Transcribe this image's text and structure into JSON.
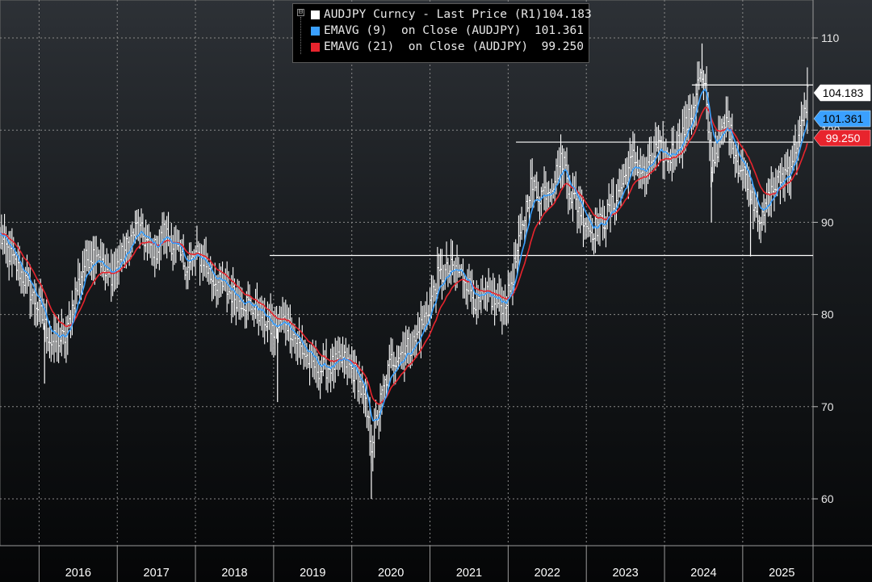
{
  "legend": {
    "collapse_symbol": "⊟",
    "entries": [
      {
        "label": "AUDJPY Curncy - Last Price (R1)",
        "value": "104.183",
        "color": "#ffffff"
      },
      {
        "label": "EMAVG (9)  on Close (AUDJPY)",
        "value": "101.361",
        "color": "#3aa0ff"
      },
      {
        "label": "EMAVG (21)  on Close (AUDJPY)",
        "value": "99.250",
        "color": "#e8242d"
      }
    ]
  },
  "price_tags": [
    {
      "text": "104.183",
      "value": 104.183,
      "bg": "#ffffff",
      "fg": "#000000"
    },
    {
      "text": "101.361",
      "value": 101.361,
      "bg": "#3aa0ff",
      "fg": "#000000"
    },
    {
      "text": "99.250",
      "value": 99.25,
      "bg": "#e8242d",
      "fg": "#ffffff"
    }
  ],
  "chart_data": {
    "type": "line",
    "title": "",
    "xlabel": "",
    "ylabel": "",
    "x_range": [
      2015.5,
      2025.9
    ],
    "ylim": [
      55.5,
      112.5
    ],
    "y_ticks": [
      60,
      70,
      80,
      90,
      100,
      110
    ],
    "y_tick_labels": [
      "60",
      "70",
      "80",
      "90",
      "100",
      "110"
    ],
    "x_ticks": [
      2016,
      2017,
      2018,
      2019,
      2020,
      2021,
      2022,
      2023,
      2024,
      2025
    ],
    "x_tick_labels": [
      "2016",
      "2017",
      "2018",
      "2019",
      "2020",
      "2021",
      "2022",
      "2023",
      "2024",
      "2025"
    ],
    "grid": true,
    "legend_position": "top-center",
    "series": [
      {
        "name": "AUDJPY Curncy - Last Price (R1)",
        "style": "weekly-bars",
        "color": "#ffffff",
        "anchor_points": [
          [
            2015.5,
            88.5
          ],
          [
            2015.65,
            86
          ],
          [
            2015.8,
            84
          ],
          [
            2016.0,
            80.5
          ],
          [
            2016.15,
            77
          ],
          [
            2016.35,
            77.5
          ],
          [
            2016.45,
            82
          ],
          [
            2016.6,
            86
          ],
          [
            2016.75,
            87
          ],
          [
            2016.85,
            84
          ],
          [
            2016.95,
            84.5
          ],
          [
            2017.1,
            87
          ],
          [
            2017.25,
            89.5
          ],
          [
            2017.4,
            87.5
          ],
          [
            2017.5,
            87
          ],
          [
            2017.6,
            89
          ],
          [
            2017.75,
            87
          ],
          [
            2017.9,
            85
          ],
          [
            2018.0,
            86.5
          ],
          [
            2018.1,
            86
          ],
          [
            2018.2,
            84
          ],
          [
            2018.35,
            83
          ],
          [
            2018.5,
            82
          ],
          [
            2018.7,
            81
          ],
          [
            2018.85,
            80
          ],
          [
            2019.0,
            78
          ],
          [
            2019.15,
            79.5
          ],
          [
            2019.3,
            77
          ],
          [
            2019.45,
            75
          ],
          [
            2019.6,
            74
          ],
          [
            2019.75,
            74.5
          ],
          [
            2019.9,
            75
          ],
          [
            2020.05,
            73.5
          ],
          [
            2020.15,
            71
          ],
          [
            2020.25,
            66
          ],
          [
            2020.35,
            70
          ],
          [
            2020.5,
            75
          ],
          [
            2020.65,
            76
          ],
          [
            2020.8,
            77
          ],
          [
            2020.95,
            80
          ],
          [
            2021.1,
            84
          ],
          [
            2021.3,
            85
          ],
          [
            2021.45,
            84
          ],
          [
            2021.6,
            81
          ],
          [
            2021.75,
            82
          ],
          [
            2021.9,
            81
          ],
          [
            2022.0,
            82
          ],
          [
            2022.15,
            88
          ],
          [
            2022.28,
            94
          ],
          [
            2022.4,
            93
          ],
          [
            2022.55,
            94
          ],
          [
            2022.7,
            97
          ],
          [
            2022.8,
            93
          ],
          [
            2022.95,
            91
          ],
          [
            2023.05,
            89
          ],
          [
            2023.2,
            90
          ],
          [
            2023.35,
            92
          ],
          [
            2023.5,
            95
          ],
          [
            2023.6,
            97
          ],
          [
            2023.75,
            95
          ],
          [
            2023.9,
            98
          ],
          [
            2024.05,
            97
          ],
          [
            2024.2,
            99
          ],
          [
            2024.35,
            102
          ],
          [
            2024.45,
            106
          ],
          [
            2024.52,
            104
          ],
          [
            2024.6,
            96
          ],
          [
            2024.7,
            99
          ],
          [
            2024.8,
            101
          ],
          [
            2024.95,
            96
          ],
          [
            2025.05,
            95
          ],
          [
            2025.15,
            92
          ],
          [
            2025.25,
            90
          ],
          [
            2025.35,
            93
          ],
          [
            2025.5,
            95
          ],
          [
            2025.6,
            96
          ],
          [
            2025.7,
            99
          ],
          [
            2025.78,
            101
          ],
          [
            2025.83,
            104.2
          ]
        ]
      },
      {
        "name": "EMAVG (9)  on Close (AUDJPY)",
        "style": "line",
        "color": "#3aa0ff",
        "smoothing_periods": 9
      },
      {
        "name": "EMAVG (21)  on Close (AUDJPY)",
        "style": "line",
        "color": "#e8242d",
        "smoothing_periods": 21
      }
    ],
    "reference_lines": [
      {
        "value": 86.4,
        "x_start": 2018.95,
        "x_end": 2025.9
      },
      {
        "value": 98.7,
        "x_start": 2022.1,
        "x_end": 2025.9
      },
      {
        "value": 104.9,
        "x_start": 2024.35,
        "x_end": 2025.9
      }
    ],
    "spikes": [
      {
        "x": 2016.07,
        "low": 72.5
      },
      {
        "x": 2019.05,
        "low": 70.5
      },
      {
        "x": 2020.25,
        "low": 60
      },
      {
        "x": 2024.6,
        "low": 90
      },
      {
        "x": 2025.1,
        "low": 86.3
      },
      {
        "x": 2024.48,
        "high": 109.4
      }
    ]
  }
}
